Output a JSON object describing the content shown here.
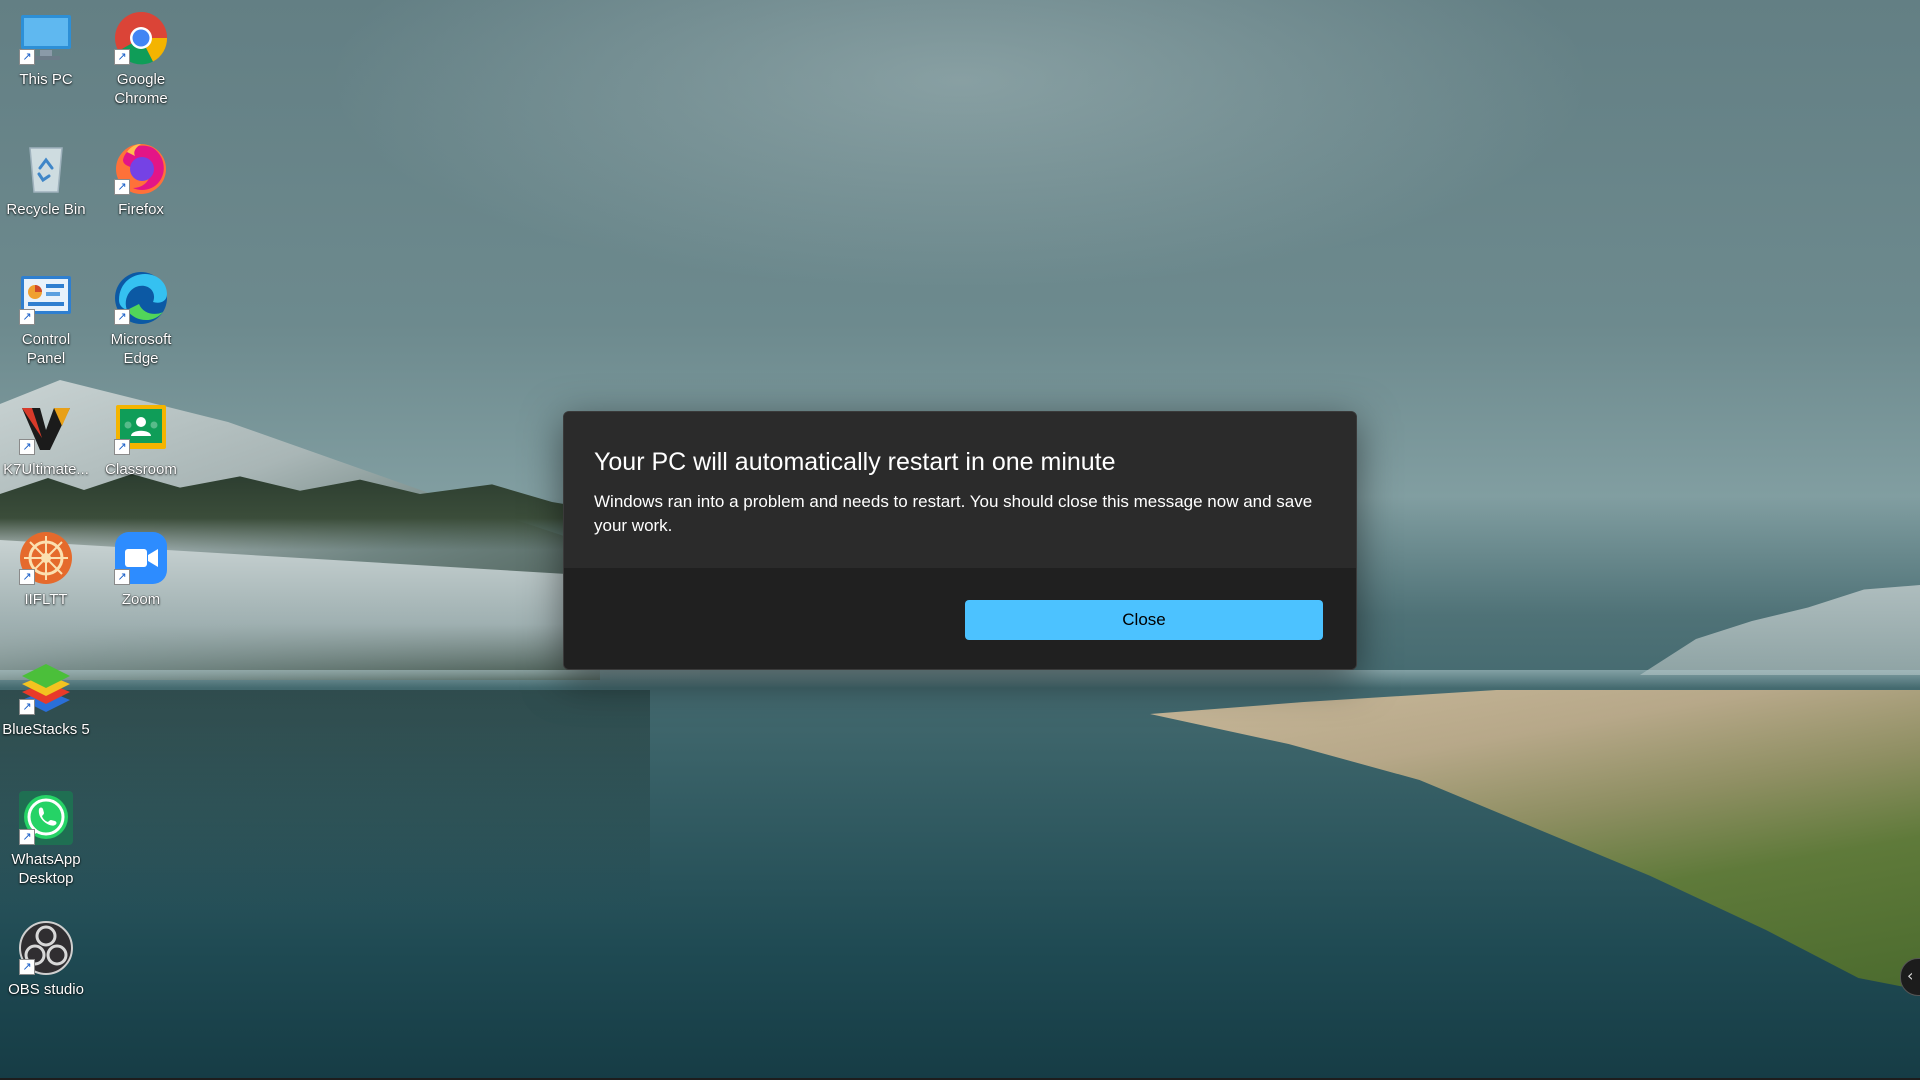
{
  "desktop": {
    "icons": [
      {
        "label": "This PC",
        "icon": "computer-monitor-icon"
      },
      {
        "label": "Google Chrome",
        "icon": "chrome-logo-icon"
      },
      {
        "label": "Recycle Bin",
        "icon": "recycle-bin-icon"
      },
      {
        "label": "Firefox",
        "icon": "firefox-logo-icon"
      },
      {
        "label": "Control Panel",
        "icon": "control-panel-icon"
      },
      {
        "label": "Microsoft Edge",
        "icon": "edge-logo-icon"
      },
      {
        "label": "K7Ultimate...",
        "icon": "k7-security-icon"
      },
      {
        "label": "Classroom",
        "icon": "google-classroom-icon"
      },
      {
        "label": "IIFLTT",
        "icon": "iifltt-icon"
      },
      {
        "label": "Zoom",
        "icon": "zoom-logo-icon"
      },
      {
        "label": "BlueStacks 5",
        "icon": "bluestacks-logo-icon"
      },
      {
        "label": "WhatsApp Desktop",
        "icon": "whatsapp-logo-icon"
      },
      {
        "label": "OBS studio",
        "icon": "obs-studio-icon"
      }
    ],
    "shortcut_arrow": "↗"
  },
  "dialog": {
    "title": "Your PC will automatically restart in one minute",
    "message": "Windows ran into a problem and needs to restart. You should close this message now and save your work.",
    "close_label": "Close",
    "accent_color": "#4cc2ff"
  },
  "edge_handle": {
    "glyph": "‹"
  }
}
